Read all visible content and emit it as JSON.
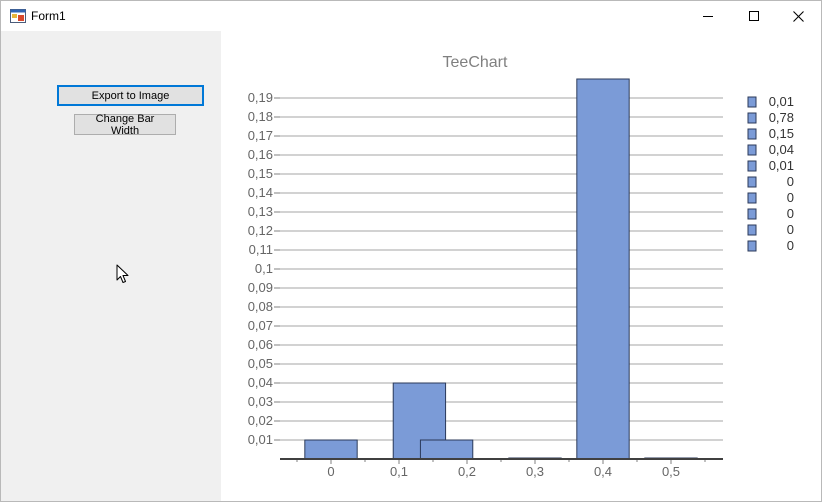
{
  "window": {
    "title": "Form1",
    "icons": {
      "app": "form-app-icon",
      "minimize": "minimize-icon",
      "maximize": "maximize-icon",
      "close": "close-icon"
    }
  },
  "buttons": {
    "export_label": "Export to Image",
    "change_width_label": "Change Bar Width"
  },
  "colors": {
    "bar_fill": "#7b9bd7",
    "bar_stroke": "#2b3a5a",
    "focus_border": "#0078d7",
    "title": "#808080"
  },
  "chart_data": {
    "type": "bar",
    "title": "TeeChart",
    "xlabel": "",
    "ylabel": "",
    "xlim": [
      -0.075,
      0.575
    ],
    "ylim": [
      0,
      0.2
    ],
    "grid": true,
    "legend_position": "right",
    "x_ticks": [
      "0",
      "0,1",
      "0,2",
      "0,3",
      "0,4",
      "0,5"
    ],
    "x_tick_values": [
      0,
      0.1,
      0.2,
      0.3,
      0.4,
      0.5
    ],
    "y_ticks": [
      "0,01",
      "0,02",
      "0,03",
      "0,04",
      "0,05",
      "0,06",
      "0,07",
      "0,08",
      "0,09",
      "0,1",
      "0,11",
      "0,12",
      "0,13",
      "0,14",
      "0,15",
      "0,16",
      "0,17",
      "0,18",
      "0,19"
    ],
    "y_tick_values": [
      0.01,
      0.02,
      0.03,
      0.04,
      0.05,
      0.06,
      0.07,
      0.08,
      0.09,
      0.1,
      0.11,
      0.12,
      0.13,
      0.14,
      0.15,
      0.16,
      0.17,
      0.18,
      0.19
    ],
    "bar_width": 0.077,
    "bars": [
      {
        "x": 0.0,
        "y": 0.01
      },
      {
        "x": 0.13,
        "y": 0.04
      },
      {
        "x": 0.17,
        "y": 0.01
      },
      {
        "x": 0.4,
        "y": 0.78
      },
      {
        "x": 0.3,
        "y": 0.0
      },
      {
        "x": 0.5,
        "y": 0.0
      }
    ],
    "legend": [
      "0,01",
      "0,78",
      "0,15",
      "0,04",
      "0,01",
      "0",
      "0",
      "0",
      "0",
      "0"
    ]
  }
}
